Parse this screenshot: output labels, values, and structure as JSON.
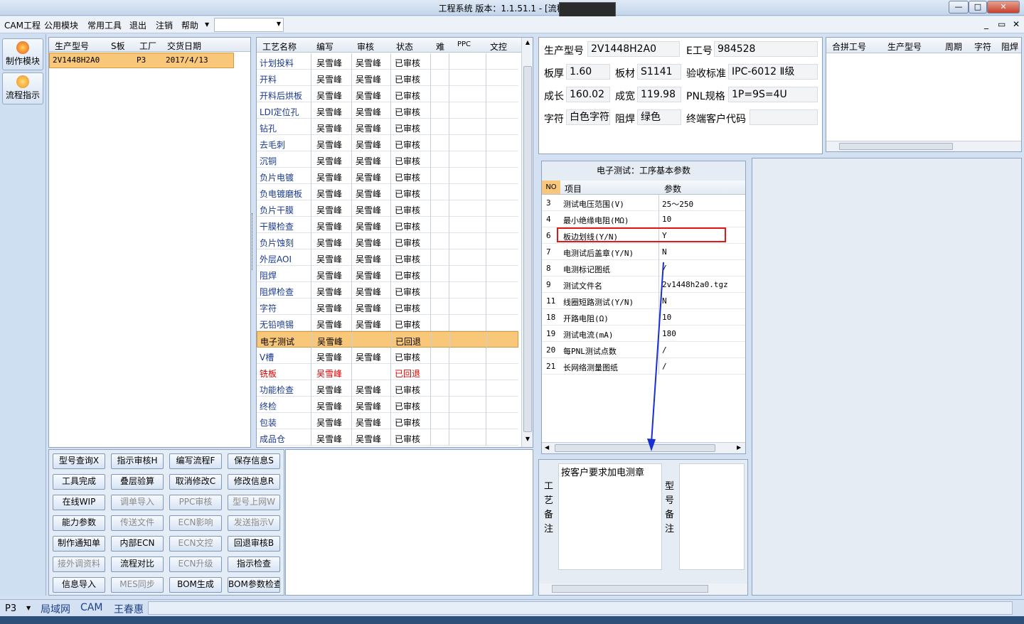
{
  "window": {
    "title": "工程系统   版本：1.1.51.1 - [流程指示]",
    "min": "—",
    "max": "□",
    "close": "✕"
  },
  "menubar": {
    "items": [
      "CAM工程",
      "公用模块",
      "常用工具",
      "退出",
      "注销",
      "帮助"
    ],
    "right_controls": [
      "_",
      "▭",
      "✕"
    ]
  },
  "rail": {
    "buttons": [
      {
        "label": "制作模块",
        "icon": "flame-icon",
        "color": "#e8571c"
      },
      {
        "label": "流程指示",
        "icon": "bars-icon",
        "color": "#f08a16"
      }
    ]
  },
  "model_list": {
    "headers": [
      "生产型号",
      "S板",
      "工厂",
      "交货日期"
    ],
    "rows": [
      [
        "2V1448H2A0",
        "",
        "P3",
        "2017/4/13"
      ]
    ]
  },
  "process_table": {
    "headers": [
      "工艺名称",
      "编写",
      "审核",
      "状态",
      "难",
      "PPC",
      "文控"
    ],
    "rows": [
      [
        "计划投料",
        "吴雪峰",
        "吴雪峰",
        "已审核"
      ],
      [
        "开料",
        "吴雪峰",
        "吴雪峰",
        "已审核"
      ],
      [
        "开料后烘板",
        "吴雪峰",
        "吴雪峰",
        "已审核"
      ],
      [
        "LDI定位孔",
        "吴雪峰",
        "吴雪峰",
        "已审核"
      ],
      [
        "钻孔",
        "吴雪峰",
        "吴雪峰",
        "已审核"
      ],
      [
        "去毛刺",
        "吴雪峰",
        "吴雪峰",
        "已审核"
      ],
      [
        "沉铜",
        "吴雪峰",
        "吴雪峰",
        "已审核"
      ],
      [
        "负片电镀",
        "吴雪峰",
        "吴雪峰",
        "已审核"
      ],
      [
        "负电镀磨板",
        "吴雪峰",
        "吴雪峰",
        "已审核"
      ],
      [
        "负片干膜",
        "吴雪峰",
        "吴雪峰",
        "已审核"
      ],
      [
        "干膜检查",
        "吴雪峰",
        "吴雪峰",
        "已审核"
      ],
      [
        "负片蚀刻",
        "吴雪峰",
        "吴雪峰",
        "已审核"
      ],
      [
        "外层AOI",
        "吴雪峰",
        "吴雪峰",
        "已审核"
      ],
      [
        "阻焊",
        "吴雪峰",
        "吴雪峰",
        "已审核"
      ],
      [
        "阻焊检查",
        "吴雪峰",
        "吴雪峰",
        "已审核"
      ],
      [
        "字符",
        "吴雪峰",
        "吴雪峰",
        "已审核"
      ],
      [
        "无铅喷锡",
        "吴雪峰",
        "吴雪峰",
        "已审核"
      ],
      [
        "电子测试",
        "吴雪峰",
        "",
        "已回退"
      ],
      [
        "V槽",
        "吴雪峰",
        "吴雪峰",
        "已审核"
      ],
      [
        "铣板",
        "吴雪峰",
        "",
        "已回退"
      ],
      [
        "功能检查",
        "吴雪峰",
        "吴雪峰",
        "已审核"
      ],
      [
        "终检",
        "吴雪峰",
        "吴雪峰",
        "已审核"
      ],
      [
        "包装",
        "吴雪峰",
        "吴雪峰",
        "已审核"
      ],
      [
        "成品仓",
        "吴雪峰",
        "吴雪峰",
        "已审核"
      ]
    ]
  },
  "button_grid": [
    [
      "型号查询X",
      "指示审核H",
      "编写流程F",
      "保存信息S"
    ],
    [
      "工具完成",
      "叠层验算",
      "取消修改C",
      "修改信息R"
    ],
    [
      "在线WIP",
      "调单导入",
      "PPC审核",
      "型号上网W"
    ],
    [
      "能力参数",
      "传送文件",
      "ECN影响",
      "发送指示V"
    ],
    [
      "制作通知单",
      "内部ECN",
      "ECN文控",
      "回退审核B"
    ],
    [
      "接外调资料",
      "流程对比",
      "ECN升级",
      "指示检查"
    ],
    [
      "信息导入",
      "MES同步",
      "BOM生成",
      "BOM参数检查"
    ]
  ],
  "button_grid_disabled": [
    "调单导入",
    "PPC审核",
    "型号上网W",
    "传送文件",
    "ECN影响",
    "发送指示V",
    "ECN文控",
    "接外调资料",
    "ECN升级",
    "MES同步"
  ],
  "info": {
    "model_label": "生产型号",
    "model": "2V1448H2A0",
    "eno_label": "E工号",
    "eno": "984528",
    "thickness_label": "板厚",
    "thickness": "1.60",
    "material_label": "板材",
    "material": "S1141",
    "standard_label": "验收标准",
    "standard": "IPC-6012 Ⅱ级",
    "length_label": "成长",
    "length": "160.02",
    "width_label": "成宽",
    "width": "119.98",
    "pnl_label": "PNL规格",
    "pnl": "1P=9S=4U",
    "char_label": "字符",
    "char": "白色字符",
    "mask_label": "阻焊",
    "mask": "绿色",
    "customer_label": "终端客户代码",
    "customer": ""
  },
  "merge_table": {
    "headers": [
      "合拼工号",
      "生产型号",
      "周期",
      "字符",
      "阻焊"
    ]
  },
  "param_panel": {
    "title": "电子测试：工序基本参数",
    "headers": [
      "NO",
      "项目",
      "参数"
    ],
    "rows": [
      [
        "3",
        "测试电压范围(V)",
        "25～250"
      ],
      [
        "4",
        "最小绝缘电阻(MΩ)",
        "10"
      ],
      [
        "6",
        "板边划线(Y/N)",
        "Y"
      ],
      [
        "7",
        "电测试后盖章(Y/N)",
        "N"
      ],
      [
        "8",
        "电测标记图纸",
        "/"
      ],
      [
        "9",
        "测试文件名",
        "2v1448h2a0.tgz"
      ],
      [
        "11",
        "线圈短路测试(Y/N)",
        "N"
      ],
      [
        "18",
        "开路电阻(Ω)",
        "10"
      ],
      [
        "19",
        "测试电流(mA)",
        "180"
      ],
      [
        "20",
        "每PNL测试点数",
        "/"
      ],
      [
        "21",
        "长网络测量图纸",
        "/"
      ]
    ]
  },
  "notes": {
    "process_label": "工艺备注",
    "process_text": "按客户要求加电测章",
    "model_label": "型号备注",
    "model_text": ""
  },
  "statusbar": {
    "factory": "P3",
    "items": [
      "局域网",
      "CAM",
      "王春惠"
    ]
  },
  "colors": {
    "selected_row": "#f9c77a",
    "highlight_box": "#e01818",
    "arrow": "#1a2fd0",
    "returned_text": "#e00000"
  }
}
